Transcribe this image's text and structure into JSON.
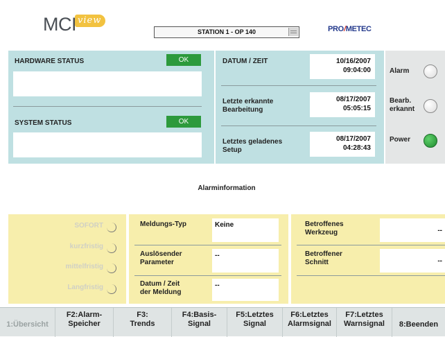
{
  "header": {
    "logo_main": "MCI",
    "logo_sub": "view",
    "station": "STATION 1 - OP 140",
    "brand": {
      "part1": "PRO",
      "slash": "/",
      "part2": "METEC"
    }
  },
  "status": {
    "hardware_label": "HARDWARE STATUS",
    "hardware_value": "OK",
    "system_label": "SYSTEM STATUS",
    "system_value": "OK"
  },
  "datetime": {
    "label": "DATUM / ZEIT",
    "date": "10/16/2007",
    "time": "09:04:00",
    "last_machining_label1": "Letzte erkannte",
    "last_machining_label2": "Bearbeitung",
    "last_machining_date": "08/17/2007",
    "last_machining_time": "05:05:15",
    "last_setup_label1": "Letztes geladenes",
    "last_setup_label2": "Setup",
    "last_setup_date": "08/17/2007",
    "last_setup_time": "04:28:43"
  },
  "indicators": {
    "alarm": "Alarm",
    "bearb1": "Bearb.",
    "bearb2": "erkannt",
    "power": "Power",
    "power_on": true,
    "colors": {
      "power_on": "#2d9a3c",
      "ok": "#2d9a3c"
    }
  },
  "alarm_info": {
    "title": "Alarminformation",
    "levels": [
      "SOFORT",
      "kurzfristig",
      "mittelfristig",
      "Langfristig"
    ],
    "meldungs_typ_label": "Meldungs-Typ",
    "meldungs_typ_value": "Keine",
    "ausl_param_label1": "Auslösender",
    "ausl_param_label2": "Parameter",
    "ausl_param_value": "--",
    "datum_meldung_label1": "Datum / Zeit",
    "datum_meldung_label2": "der Meldung",
    "datum_meldung_value": "--",
    "betr_werkzeug_label1": "Betroffenes",
    "betr_werkzeug_label2": "Werkzeug",
    "betr_werkzeug_value": "--",
    "betr_schnitt_label1": "Betroffener",
    "betr_schnitt_label2": "Schnitt",
    "betr_schnitt_value": "--"
  },
  "footer": {
    "buttons": [
      {
        "line1": "",
        "line2": "1:Übersicht",
        "dim": true
      },
      {
        "line1": "F2:Alarm-",
        "line2": "Speicher"
      },
      {
        "line1": "F3:",
        "line2": "Trends"
      },
      {
        "line1": "F4:Basis-",
        "line2": "Signal"
      },
      {
        "line1": "F5:Letztes",
        "line2": "Signal"
      },
      {
        "line1": "F6:Letztes",
        "line2": "Alarmsignal"
      },
      {
        "line1": "F7:Letztes",
        "line2": "Warnsignal"
      },
      {
        "line1": "",
        "line2": "8:Beenden"
      }
    ]
  }
}
